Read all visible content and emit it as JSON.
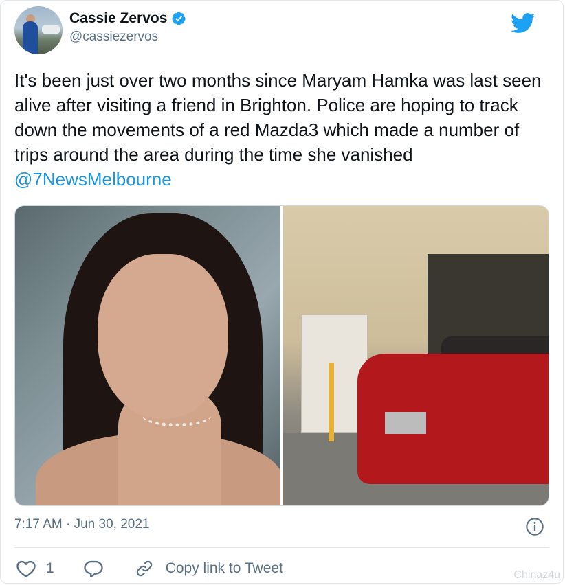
{
  "author": {
    "display_name": "Cassie Zervos",
    "handle": "@cassiezervos",
    "verified": true,
    "avatar_icon": "profile-photo"
  },
  "brand_icon": "twitter-bird-icon",
  "tweet": {
    "text": "It's been just over two months since Maryam Hamka was last seen alive after visiting a friend in Brighton. Police are hoping to track down the movements of a red Mazda3 which made a number of trips around the area during the time she vanished ",
    "mention": "@7NewsMelbourne"
  },
  "media": {
    "left_photo": "photo of a woman with dark hair",
    "right_photo": "red car exiting a garage"
  },
  "meta": {
    "timestamp": "7:17 AM · Jun 30, 2021"
  },
  "actions": {
    "like_count": "1",
    "copy_link_label": "Copy link to Tweet"
  },
  "watermark": "Chinaz4u",
  "colors": {
    "link": "#1b95e0",
    "brand": "#1da1f2",
    "muted": "#5b7083",
    "text": "#0f1419"
  }
}
